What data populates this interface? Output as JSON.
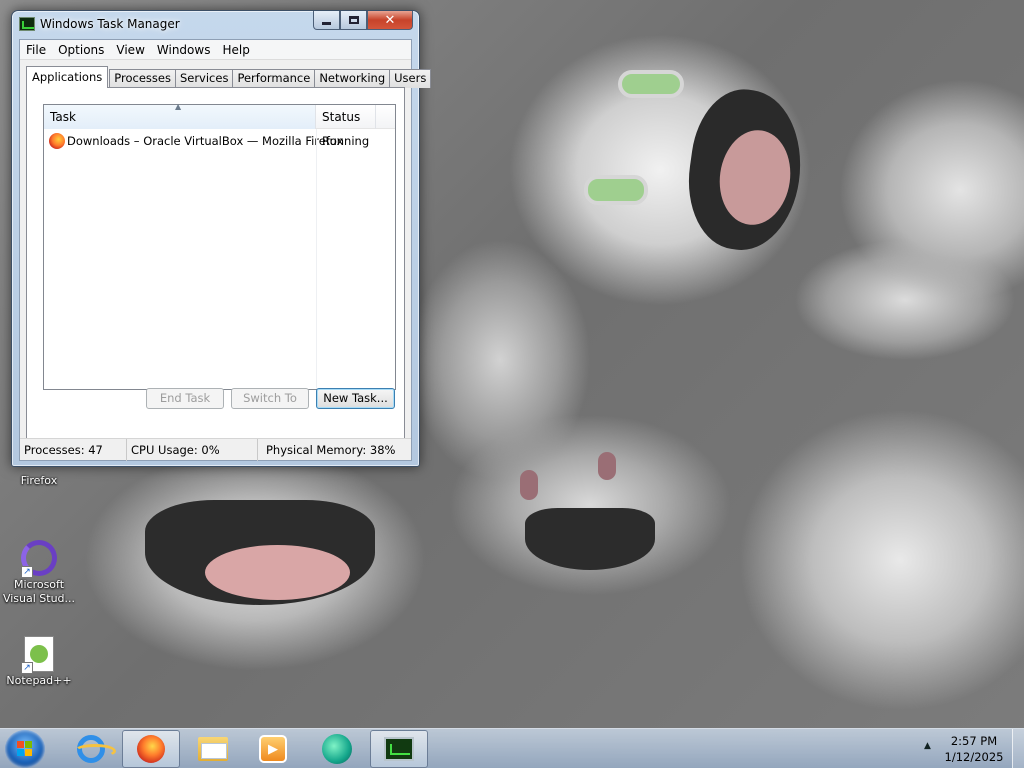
{
  "window": {
    "title": "Windows Task Manager",
    "menu": [
      "File",
      "Options",
      "View",
      "Windows",
      "Help"
    ],
    "tabs": [
      "Applications",
      "Processes",
      "Services",
      "Performance",
      "Networking",
      "Users"
    ],
    "active_tab": "Applications",
    "list": {
      "columns": {
        "task": "Task",
        "status": "Status"
      },
      "rows": [
        {
          "task": "Downloads – Oracle VirtualBox — Mozilla Firefox",
          "status": "Running",
          "icon": "firefox-icon"
        }
      ]
    },
    "buttons": {
      "end_task": "End Task",
      "switch_to": "Switch To",
      "new_task": "New Task..."
    },
    "status_bar": {
      "processes": "Processes: 47",
      "cpu": "CPU Usage: 0%",
      "memory": "Physical Memory: 38%"
    }
  },
  "desktop_icons": [
    {
      "label": "Firefox",
      "icon": "firefox-icon"
    },
    {
      "label": "Microsoft Visual Stud...",
      "icon": "visual-studio-icon"
    },
    {
      "label": "Notepad++",
      "icon": "notepad-plus-plus-icon"
    }
  ],
  "taskbar": {
    "pinned": [
      "internet-explorer-icon",
      "firefox-icon",
      "windows-explorer-icon",
      "windows-media-player-icon",
      "feedback-hub-icon",
      "task-manager-icon"
    ],
    "active": [
      "firefox-icon",
      "task-manager-icon"
    ],
    "clock": {
      "time": "2:57 PM",
      "date": "1/12/2025"
    }
  },
  "colors": {
    "titlebar": "#c5d8ec",
    "close_button": "#c7432a",
    "taskbar": "#b4c6da"
  }
}
